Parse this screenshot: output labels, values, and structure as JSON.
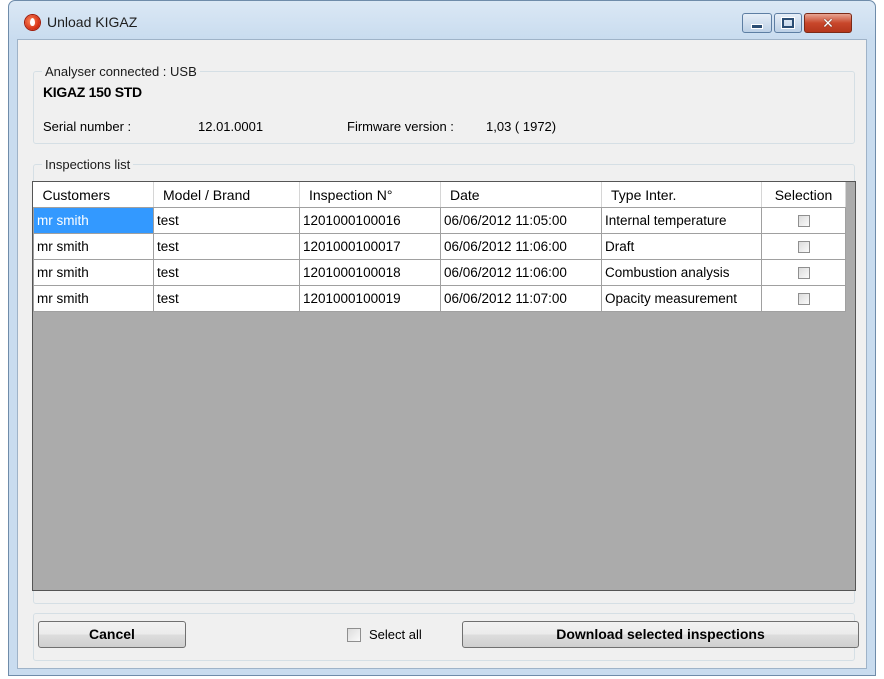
{
  "window": {
    "title": "Unload KIGAZ",
    "close_glyph": "✕"
  },
  "analyser": {
    "legend": "Analyser connected : USB",
    "device_name": "KIGAZ 150 STD",
    "serial_label": "Serial number :",
    "serial_value": "12.01.0001",
    "firmware_label": "Firmware version :",
    "firmware_value": "1,03 ( 1972)"
  },
  "inspections": {
    "legend": "Inspections list",
    "columns": [
      "Customers",
      "Model / Brand",
      "Inspection N°",
      "Date",
      "Type Inter.",
      "Selection"
    ],
    "rows": [
      {
        "customer": "mr smith",
        "model": "test",
        "number": "1201000100016",
        "date": "06/06/2012 11:05:00",
        "type": "Internal temperature"
      },
      {
        "customer": "mr smith",
        "model": "test",
        "number": "1201000100017",
        "date": "06/06/2012 11:06:00",
        "type": "Draft"
      },
      {
        "customer": "mr smith",
        "model": "test",
        "number": "1201000100018",
        "date": "06/06/2012 11:06:00",
        "type": "Combustion analysis"
      },
      {
        "customer": "mr smith",
        "model": "test",
        "number": "1201000100019",
        "date": "06/06/2012 11:07:00",
        "type": "Opacity measurement"
      }
    ]
  },
  "footer": {
    "cancel_label": "Cancel",
    "select_all_label": "Select all",
    "download_label": "Download selected inspections"
  },
  "colors": {
    "selection": "#3399ff",
    "grid_background": "#ababab",
    "window_frame": "#c9dcef"
  }
}
